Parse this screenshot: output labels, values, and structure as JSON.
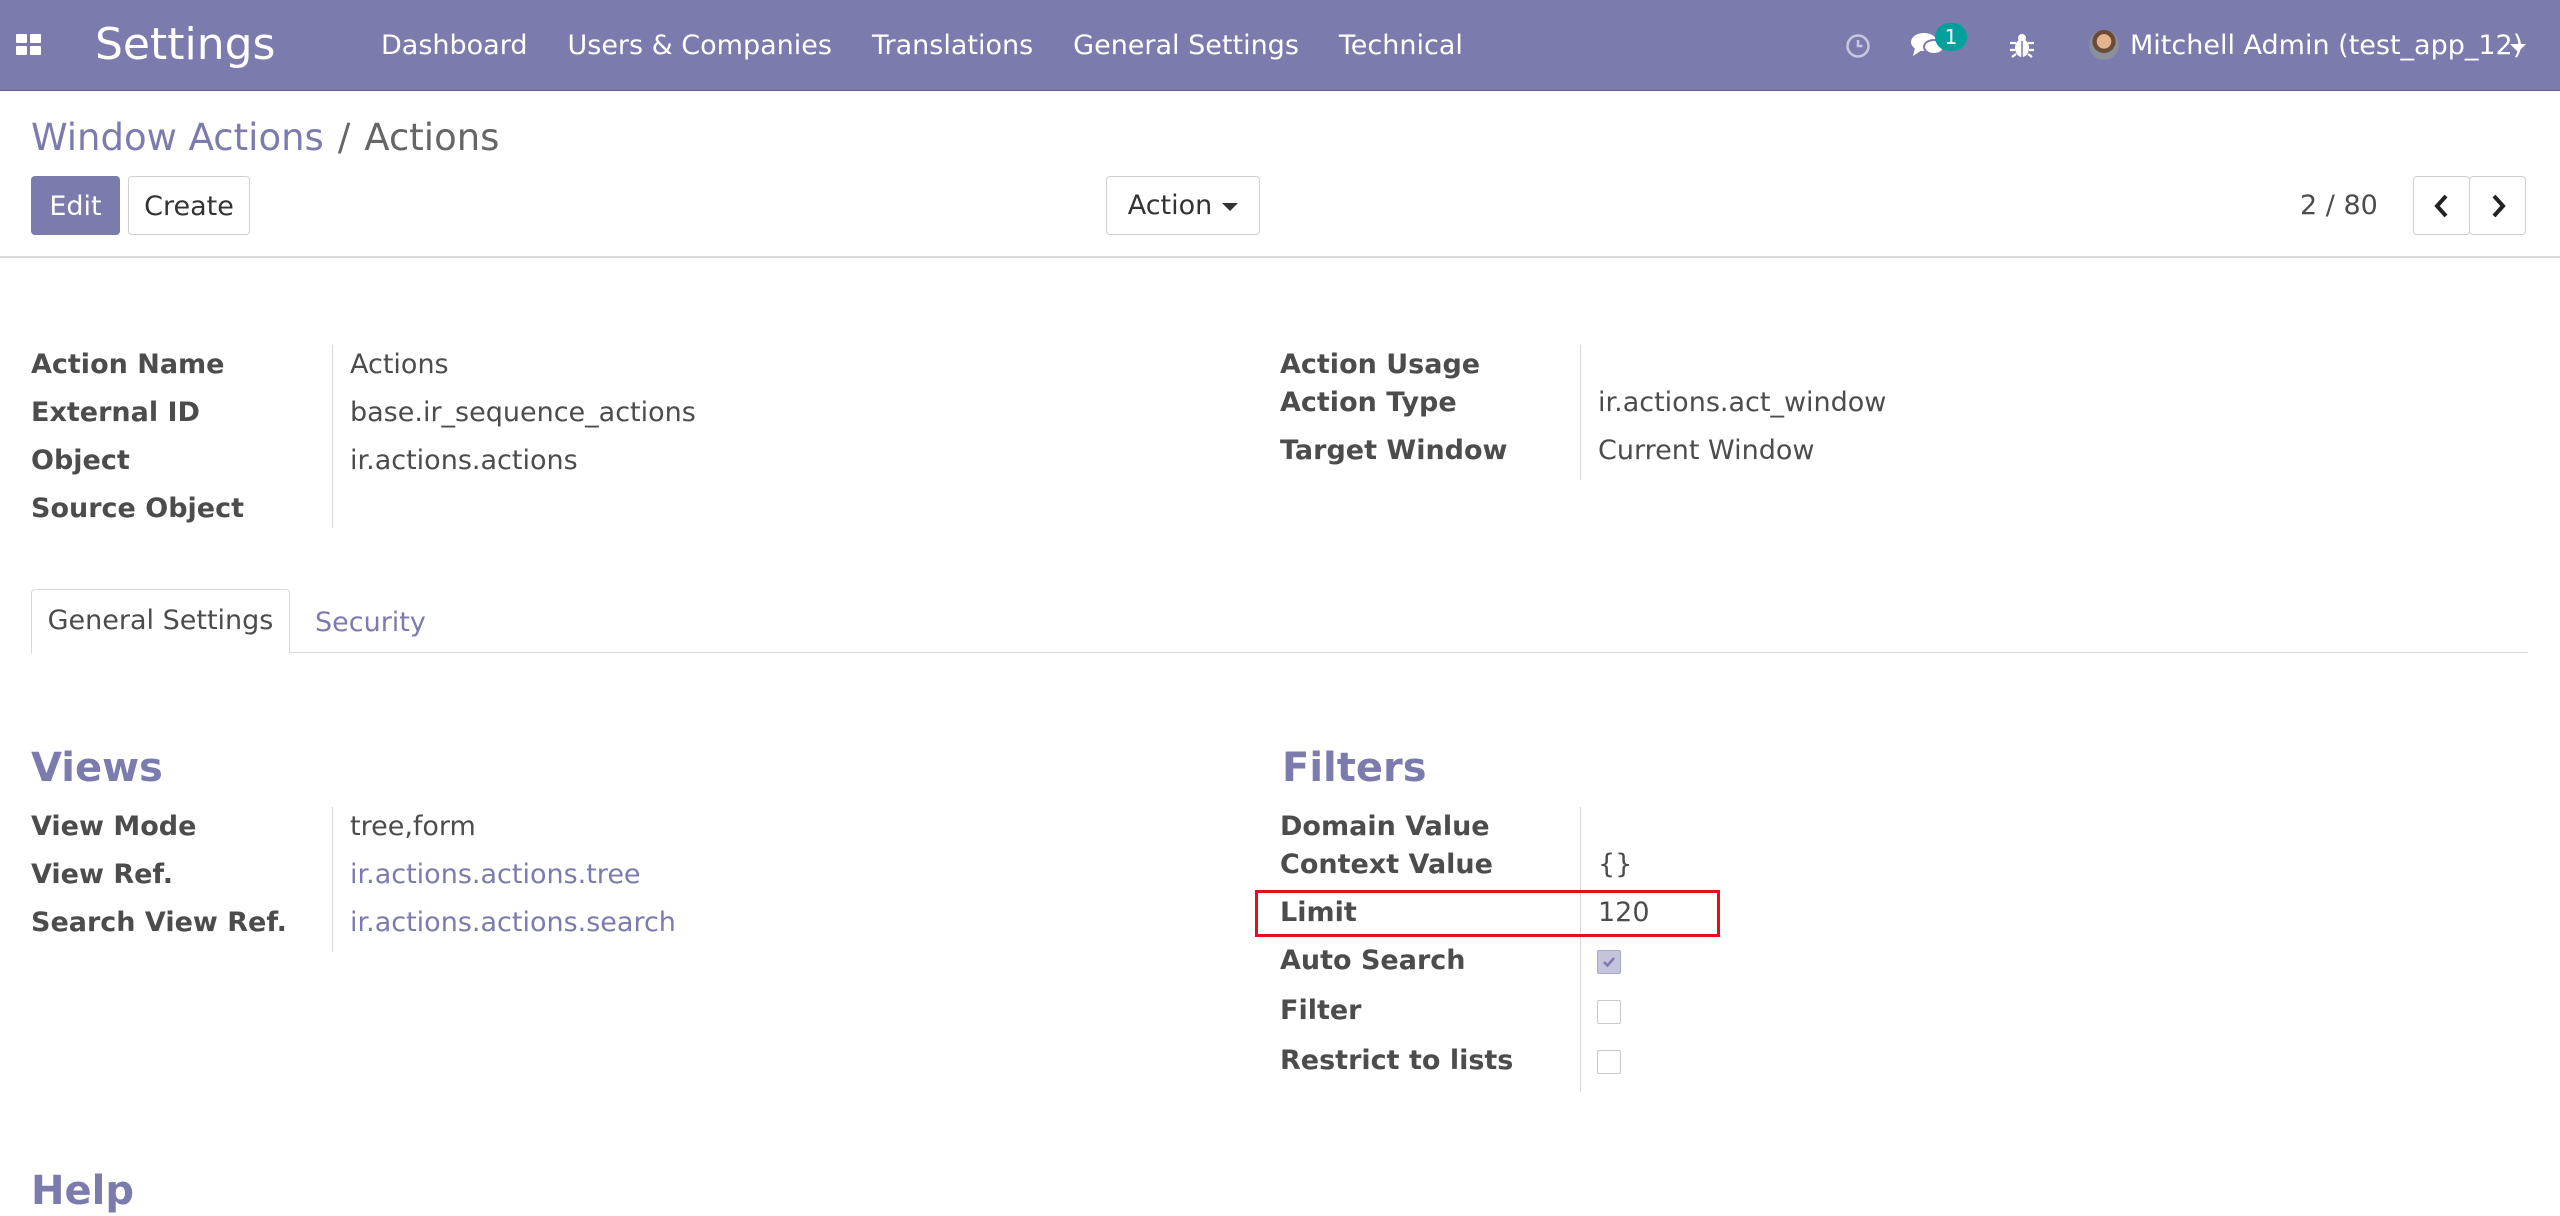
{
  "navbar": {
    "app_title": "Settings",
    "menu": [
      "Dashboard",
      "Users & Companies",
      "Translations",
      "General Settings",
      "Technical"
    ],
    "chat_badge": "1",
    "user": "Mitchell Admin (test_app_12)",
    "icons": [
      "apps-grid-icon",
      "clock-icon",
      "chat-icon",
      "bug-icon"
    ]
  },
  "breadcrumb": {
    "parent": "Window Actions",
    "separator": "/",
    "current": "Actions"
  },
  "buttons": {
    "edit": "Edit",
    "create": "Create",
    "action": "Action"
  },
  "pager": {
    "value": "2 / 80"
  },
  "header_fields": {
    "left": [
      {
        "label": "Action Name",
        "value": "Actions"
      },
      {
        "label": "External ID",
        "value": "base.ir_sequence_actions"
      },
      {
        "label": "Object",
        "value": "ir.actions.actions"
      },
      {
        "label": "Source Object",
        "value": ""
      }
    ],
    "right": [
      {
        "label": "Action Usage",
        "value": ""
      },
      {
        "label": "Action Type",
        "value": "ir.actions.act_window"
      },
      {
        "label": "Target Window",
        "value": "Current Window"
      }
    ]
  },
  "tabs": [
    "General Settings",
    "Security"
  ],
  "views": {
    "title": "Views",
    "fields": [
      {
        "label": "View Mode",
        "value": "tree,form"
      },
      {
        "label": "View Ref.",
        "value": "ir.actions.actions.tree"
      },
      {
        "label": "Search View Ref.",
        "value": "ir.actions.actions.search"
      }
    ]
  },
  "filters": {
    "title": "Filters",
    "fields": [
      {
        "label": "Domain Value",
        "value": ""
      },
      {
        "label": "Context Value",
        "value": "{}"
      },
      {
        "label": "Limit",
        "value": "120"
      },
      {
        "label": "Auto Search",
        "checked": true
      },
      {
        "label": "Filter",
        "checked": false
      },
      {
        "label": "Restrict to lists",
        "checked": false
      }
    ]
  },
  "help": {
    "title": "Help"
  },
  "colors": {
    "brand": "#7c7bad",
    "highlight": "#e3101c",
    "badge": "#00a09d"
  }
}
